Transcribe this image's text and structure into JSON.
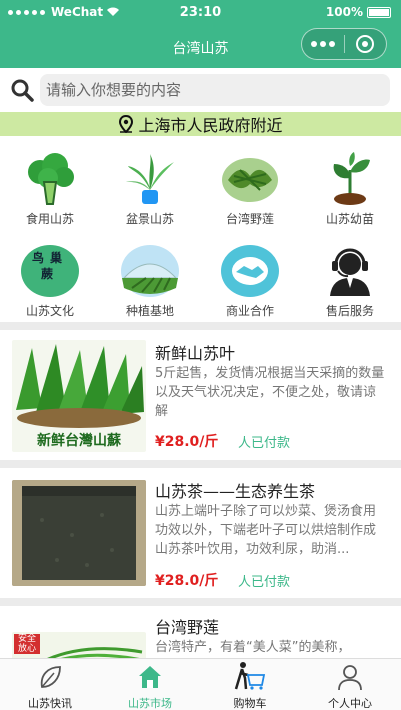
{
  "status": {
    "carrier": "WeChat",
    "time": "23:10",
    "battery": "100%"
  },
  "nav": {
    "title": "台湾山苏"
  },
  "search": {
    "placeholder": "请输入你想要的内容"
  },
  "location": {
    "text": "上海市人民政府附近"
  },
  "grid": [
    {
      "label": "食用山苏",
      "icon": "broccoli-icon"
    },
    {
      "label": "盆景山苏",
      "icon": "potted-plant-icon"
    },
    {
      "label": "台湾野莲",
      "icon": "vegetable-bowl-icon"
    },
    {
      "label": "山苏幼苗",
      "icon": "seedling-icon"
    },
    {
      "label": "山苏文化",
      "icon": "culture-badge-icon",
      "badge_text": "鸟巢蕨"
    },
    {
      "label": "种植基地",
      "icon": "greenhouse-icon"
    },
    {
      "label": "商业合作",
      "icon": "handshake-icon"
    },
    {
      "label": "售后服务",
      "icon": "headset-service-icon"
    }
  ],
  "products": [
    {
      "title": "新鲜山苏叶",
      "desc": "5斤起售，发货情况根据当天采摘的数量以及天气状况决定，不便之处，敬请谅解",
      "price": "¥28.0/斤",
      "paid": "人已付款",
      "image_caption": "新鲜台灣山蘇"
    },
    {
      "title": "山苏茶——生态养生茶",
      "desc": "山苏上端叶子除了可以炒菜、煲汤食用功效以外，下端老叶子可以烘焙制作成山苏茶叶饮用，功效利尿，助消...",
      "price": "¥28.0/斤",
      "paid": "人已付款"
    },
    {
      "title": "台湾野莲",
      "desc": "台湾特产，有着“美人菜”的美称，",
      "image_badge": "安全 放心"
    }
  ],
  "tabbar": [
    {
      "label": "山苏快讯",
      "icon": "leaf-icon"
    },
    {
      "label": "山苏市场",
      "icon": "home-icon"
    },
    {
      "label": "购物车",
      "icon": "cart-icon"
    },
    {
      "label": "个人中心",
      "icon": "user-icon"
    }
  ],
  "colors": {
    "brand": "#3db88a",
    "location_bg": "#cde9a2",
    "price": "#e02020"
  }
}
